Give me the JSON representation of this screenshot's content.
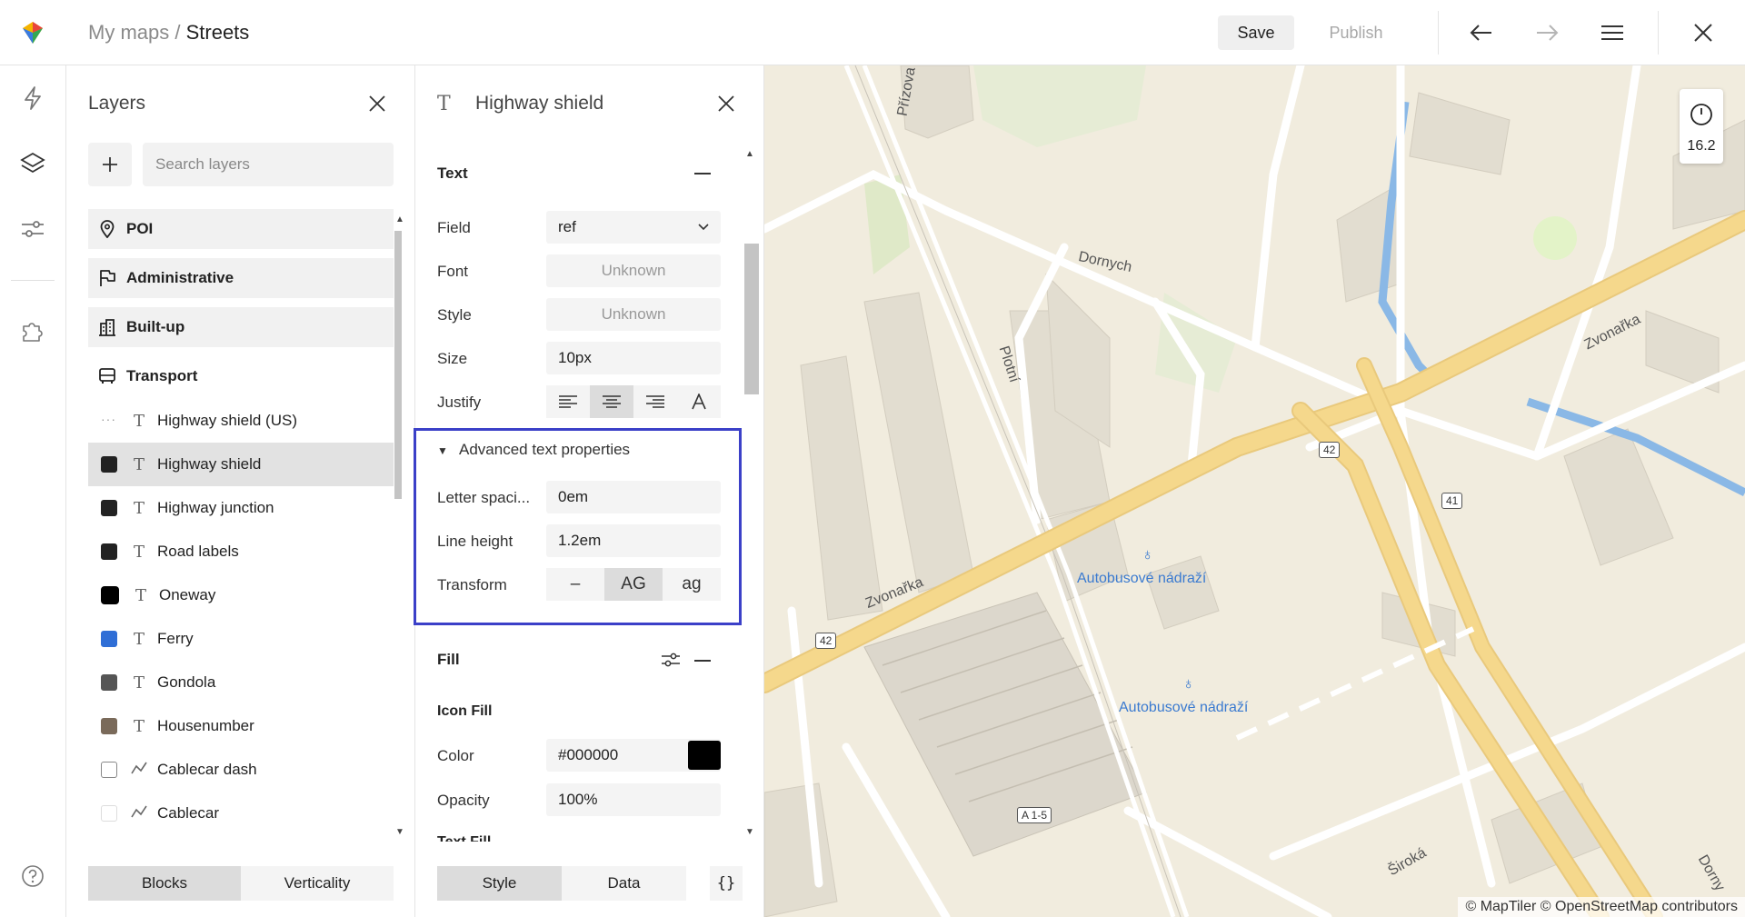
{
  "topbar": {
    "breadcrumb_parent": "My maps",
    "breadcrumb_separator": " / ",
    "breadcrumb_current": "Streets",
    "save_label": "Save",
    "publish_label": "Publish"
  },
  "layers_panel": {
    "title": "Layers",
    "search_placeholder": "Search layers",
    "groups": [
      {
        "label": "POI",
        "icon": "pin-icon"
      },
      {
        "label": "Administrative",
        "icon": "flag-icon"
      },
      {
        "label": "Built-up",
        "icon": "building-icon"
      },
      {
        "label": "Transport",
        "icon": "bus-icon"
      }
    ],
    "items": [
      {
        "label": "Highway shield (US)",
        "swatch": "dots",
        "type": "T"
      },
      {
        "label": "Highway shield",
        "swatch": "#222222",
        "type": "T",
        "selected": true
      },
      {
        "label": "Highway junction",
        "swatch": "#222222",
        "type": "T"
      },
      {
        "label": "Road labels",
        "swatch": "#222222",
        "type": "T"
      },
      {
        "label": "Oneway",
        "swatch": "#000000",
        "type": "T"
      },
      {
        "label": "Ferry",
        "swatch": "#2f6ed6",
        "type": "T"
      },
      {
        "label": "Gondola",
        "swatch": "#555555",
        "type": "T"
      },
      {
        "label": "Housenumber",
        "swatch": "#7a6a5a",
        "type": "T"
      },
      {
        "label": "Cablecar dash",
        "swatch": "outline",
        "type": "line"
      },
      {
        "label": "Cablecar",
        "swatch": "outline-light",
        "type": "line"
      }
    ],
    "tabs": {
      "blocks": "Blocks",
      "verticality": "Verticality"
    }
  },
  "props_panel": {
    "title": "Highway shield",
    "text_section": "Text",
    "field_label": "Field",
    "field_value": "ref",
    "font_label": "Font",
    "font_value": "Unknown",
    "style_label": "Style",
    "style_value": "Unknown",
    "size_label": "Size",
    "size_value": "10px",
    "justify_label": "Justify",
    "advanced_label": "Advanced text properties",
    "letter_spacing_label": "Letter spaci...",
    "letter_spacing_value": "0em",
    "line_height_label": "Line height",
    "line_height_value": "1.2em",
    "transform_label": "Transform",
    "transform_none": "–",
    "transform_upper": "AG",
    "transform_lower": "ag",
    "fill_section": "Fill",
    "icon_fill_label": "Icon Fill",
    "color_label": "Color",
    "color_value": "#000000",
    "opacity_label": "Opacity",
    "opacity_value": "100%",
    "text_fill_label": "Text Fill",
    "tabs": {
      "style": "Style",
      "data": "Data",
      "code": "{}"
    }
  },
  "map": {
    "zoom": "16.2",
    "attribution": "© MapTiler © OpenStreetMap contributors",
    "labels": {
      "prizova": "Přízova",
      "dornych": "Dornych",
      "plotni": "Plotní",
      "zvonarka_1": "Zvonařka",
      "zvonarka_2": "Zvonařka",
      "bus_station_1": "Autobusové nádraží",
      "bus_station_2": "Autobusové nádraží",
      "siroka": "Široká",
      "dornych_2": "Dorny"
    },
    "shields": {
      "s42a": "42",
      "s41": "41",
      "s42b": "42",
      "a15": "A 1-5"
    }
  },
  "colors": {
    "accent_outline": "#3b40c8",
    "road_major": "#f5d88c",
    "water": "#8ab8e6",
    "park": "#dfe9c8"
  }
}
